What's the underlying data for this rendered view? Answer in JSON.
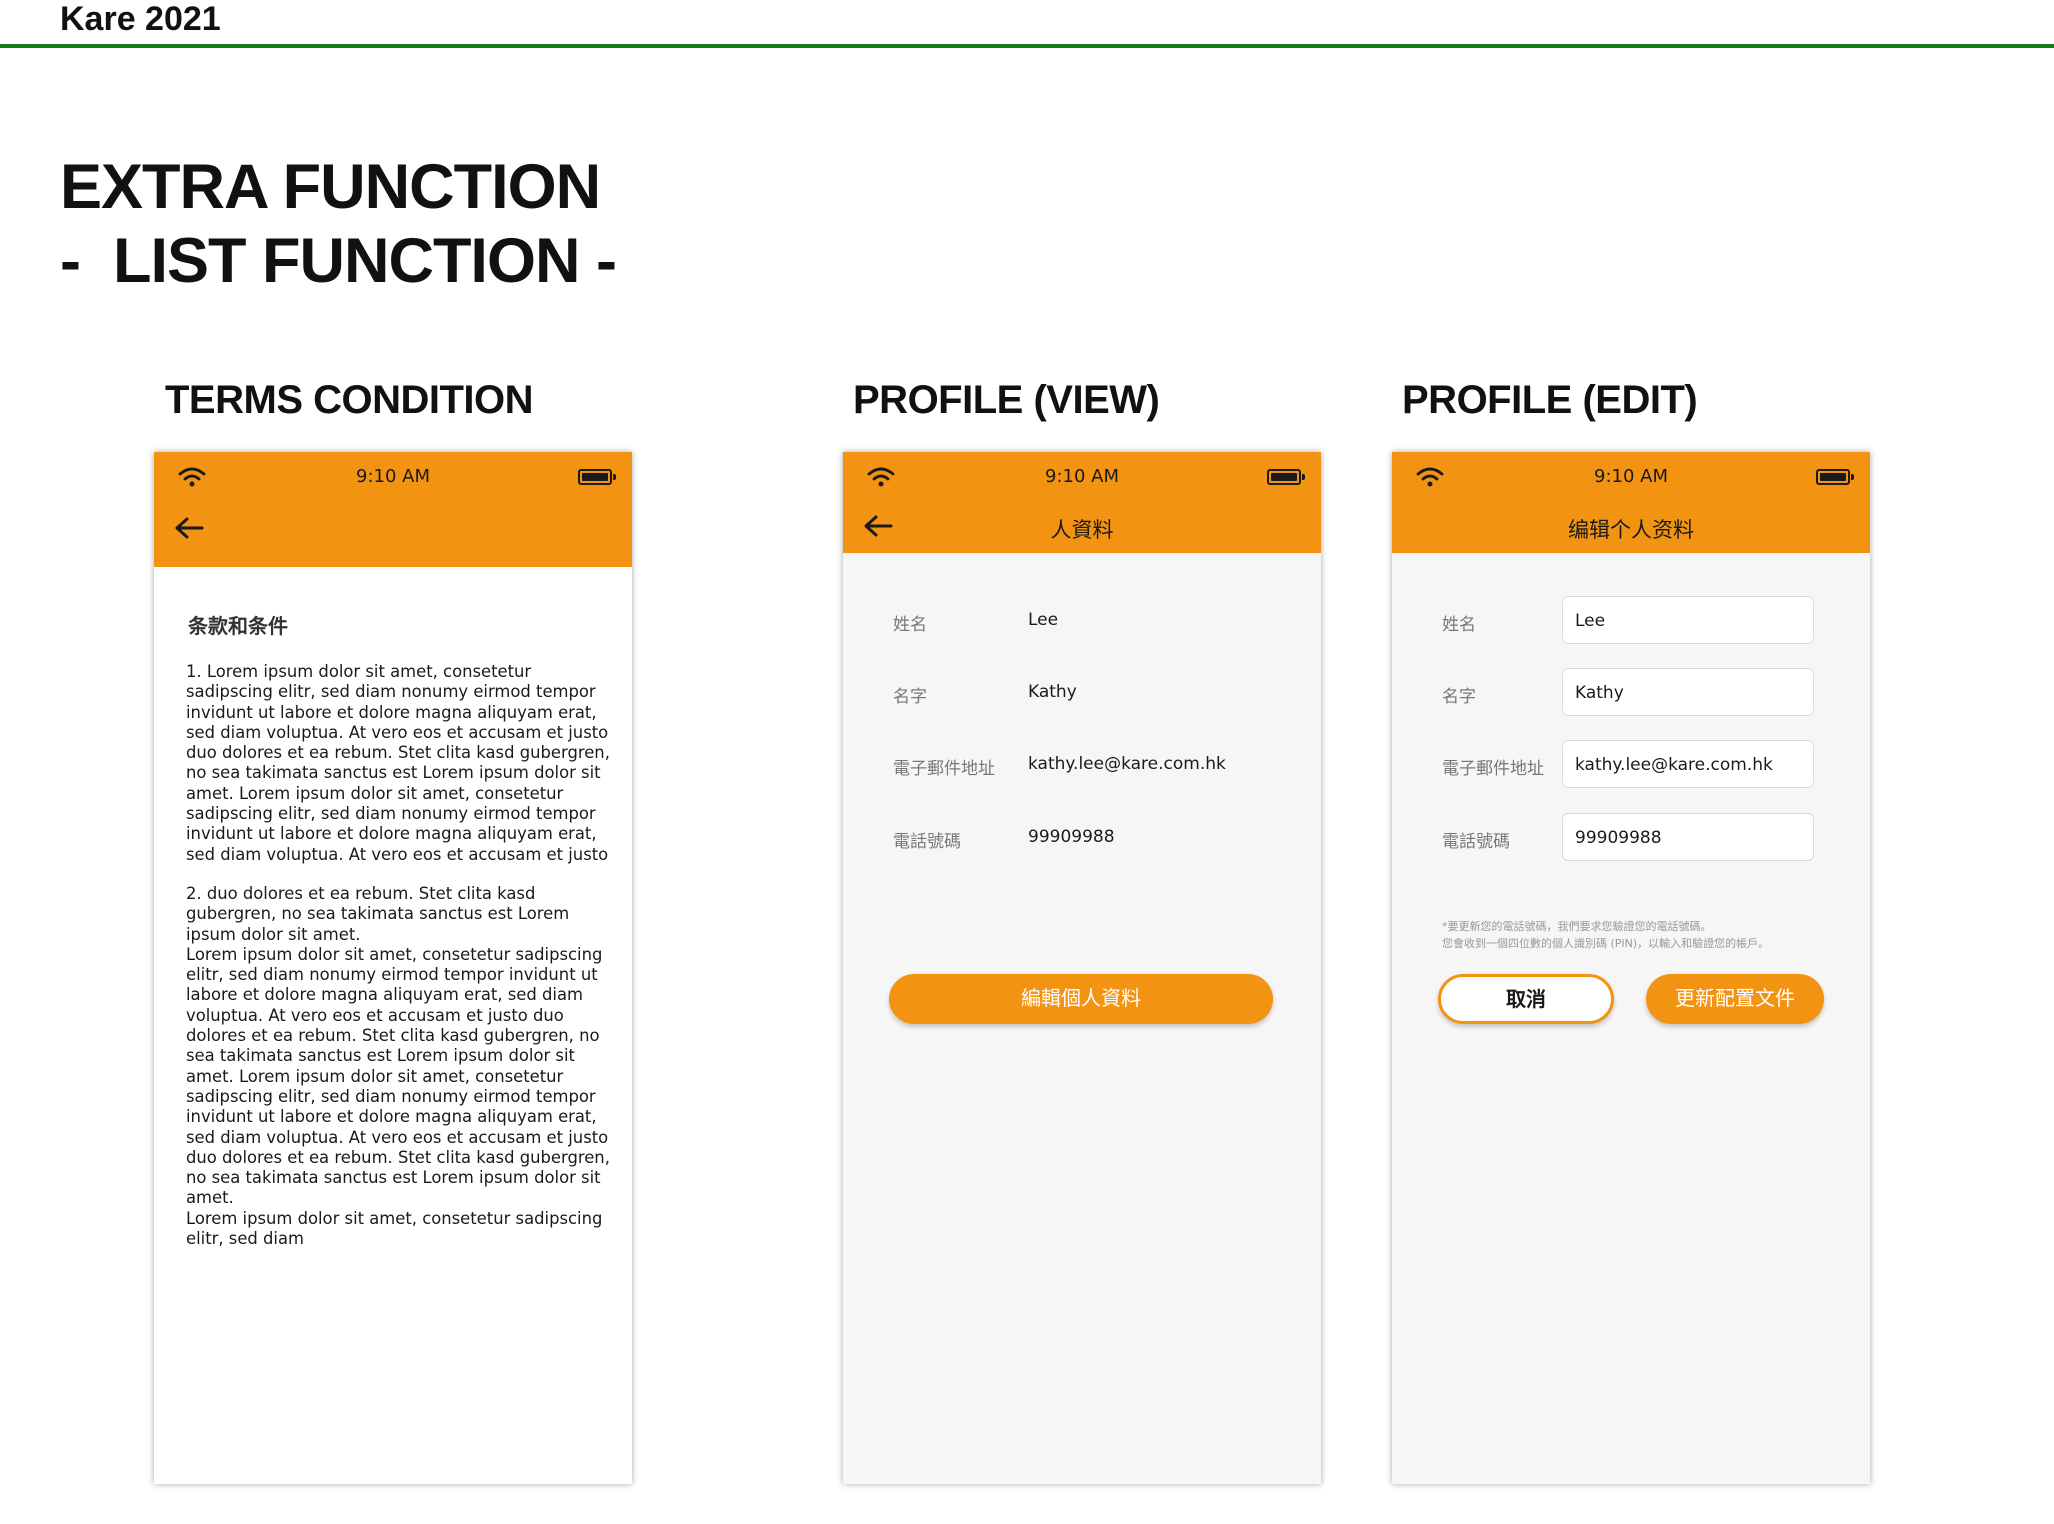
{
  "brand": {
    "title": "Kare 2021"
  },
  "page": {
    "title_line1": "EXTRA FUNCTION",
    "title_line2": "-  LIST FUNCTION -"
  },
  "status_bar": {
    "time": "9:10 AM"
  },
  "screens": {
    "terms": {
      "label": "TERMS CONDITION",
      "heading": "条款和条件",
      "para1": "1. Lorem ipsum dolor sit amet, consetetur\nsadipscing elitr, sed diam nonumy eirmod tempor\ninvidunt ut labore et dolore magna aliquyam erat,\nsed diam voluptua. At vero eos et accusam et justo\nduo dolores et ea rebum. Stet clita kasd gubergren,\nno sea takimata sanctus est Lorem ipsum dolor sit\namet. Lorem ipsum dolor sit amet, consetetur\nsadipscing elitr, sed diam nonumy eirmod tempor\ninvidunt ut labore et dolore magna aliquyam erat,\nsed diam voluptua. At vero eos et accusam et justo",
      "para2": "2. duo dolores et ea rebum. Stet clita kasd\ngubergren, no sea takimata sanctus est Lorem\nipsum dolor sit amet.\nLorem ipsum dolor sit amet, consetetur sadipscing\nelitr, sed diam nonumy eirmod tempor invidunt ut\nlabore et dolore magna aliquyam erat, sed diam\nvoluptua. At vero eos et accusam et justo duo\ndolores et ea rebum. Stet clita kasd gubergren, no\nsea takimata sanctus est Lorem ipsum dolor sit\namet. Lorem ipsum dolor sit amet, consetetur\nsadipscing elitr, sed diam nonumy eirmod tempor\ninvidunt ut labore et dolore magna aliquyam erat,\nsed diam voluptua. At vero eos et accusam et justo\nduo dolores et ea rebum. Stet clita kasd gubergren,\nno sea takimata sanctus est Lorem ipsum dolor sit\namet.\nLorem ipsum dolor sit amet, consetetur sadipscing\nelitr, sed diam"
    },
    "profile_view": {
      "label": "PROFILE (VIEW)",
      "title": "人資料",
      "fields": [
        {
          "label": "姓名",
          "value": "Lee"
        },
        {
          "label": "名字",
          "value": "Kathy"
        },
        {
          "label": "電子郵件地址",
          "value": "kathy.lee@kare.com.hk"
        },
        {
          "label": "電話號碼",
          "value": "99909988"
        }
      ],
      "edit_button": "編輯個人資料"
    },
    "profile_edit": {
      "label": "PROFILE (EDIT)",
      "title": "编辑个人资料",
      "fields": [
        {
          "label": "姓名",
          "value": "Lee"
        },
        {
          "label": "名字",
          "value": "Kathy"
        },
        {
          "label": "電子郵件地址",
          "value": "kathy.lee@kare.com.hk"
        },
        {
          "label": "電話號碼",
          "value": "99909988"
        }
      ],
      "note_line1": "*要更新您的電話號碼，我們要求您驗證您的電話號碼。",
      "note_line2": "您會收到一個四位數的個人識別碼 (PIN)，以輸入和驗證您的帳戶。",
      "cancel_button": "取消",
      "update_button": "更新配置文件"
    }
  },
  "colors": {
    "accent": "#f39312",
    "brand_line": "#1a7a1a",
    "screen_bg": "#f6f6f6"
  }
}
